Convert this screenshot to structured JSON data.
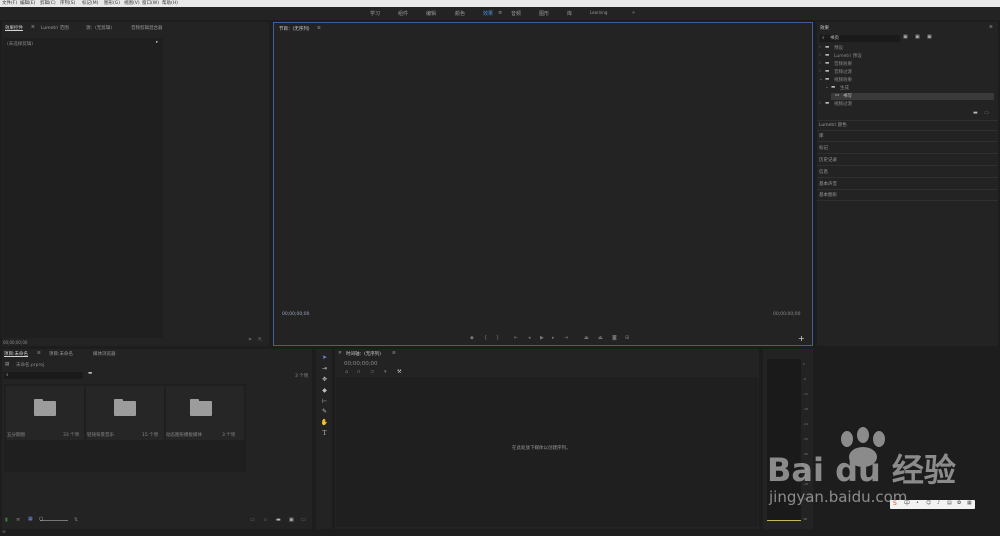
{
  "menu": [
    "文件(F)",
    "编辑(E)",
    "剪辑(C)",
    "序列(S)",
    "标记(M)",
    "图形(G)",
    "视图(V)",
    "窗口(W)",
    "帮助(H)"
  ],
  "workspaces": [
    "学习",
    "组件",
    "编辑",
    "颜色",
    "效果",
    "音频",
    "图形",
    "库",
    "Learning"
  ],
  "workspace_more": "»",
  "effect_controls": {
    "tabs": [
      "效果控件",
      "Lumetri 范围",
      "源：(无剪辑)",
      "音频剪辑混合器"
    ],
    "no_clip": "(未选择剪辑)",
    "timecode": "00;00;00;00"
  },
  "program_monitor": {
    "title": "节目：(无序列)",
    "timecode_left": "00;00;00;00",
    "timecode_right": "00;00;00;00",
    "add_icon": "+"
  },
  "effects_panel": {
    "title": "效果",
    "search_value": "书页",
    "tree": [
      {
        "label": "预设",
        "indent": 0,
        "type": "folder"
      },
      {
        "label": "Lumetri 预设",
        "indent": 0,
        "type": "folder"
      },
      {
        "label": "音频效果",
        "indent": 0,
        "type": "folder"
      },
      {
        "label": "音频过渡",
        "indent": 0,
        "type": "folder"
      },
      {
        "label": "视频效果",
        "indent": 0,
        "type": "folder"
      },
      {
        "label": "生成",
        "indent": 1,
        "type": "folder"
      },
      {
        "label": "书写",
        "indent": 2,
        "type": "effect",
        "selected": true
      },
      {
        "label": "视频过渡",
        "indent": 0,
        "type": "folder"
      }
    ],
    "sections": [
      "Lumetri 颜色",
      "库",
      "标记",
      "历史记录",
      "信息",
      "基本声音",
      "基本图形"
    ]
  },
  "project_panel": {
    "tabs": [
      "项目:未命名",
      "项目:未命名",
      "媒体浏览器"
    ],
    "path": "未命名.prproj",
    "count": "3 个项",
    "items": [
      {
        "name": "五分期图",
        "count": "33 个项"
      },
      {
        "name": "轻快背景音乐",
        "count": "15 个项"
      },
      {
        "name": "动态图形模板媒体",
        "count": "3 个项"
      }
    ]
  },
  "timeline": {
    "title": "时间轴：(无序列)",
    "timecode": "00;00;00;00",
    "hint": "在此处放下媒体以创建序列。"
  },
  "tools": [
    "selection",
    "track-select",
    "ripple-edit",
    "razor",
    "slip",
    "pen",
    "hand",
    "type"
  ],
  "audio_meter": {
    "ticks": [
      "0",
      "-6",
      "-12",
      "-18",
      "-24",
      "-30",
      "-36",
      "-42",
      "-48",
      "-54",
      "dB"
    ]
  },
  "watermark": {
    "brand": "Bai du 经验",
    "url": "jingyan.baidu.com"
  },
  "colors": {
    "accent": "#4a90e2",
    "panel": "#232323",
    "background": "#1d1d1d"
  }
}
